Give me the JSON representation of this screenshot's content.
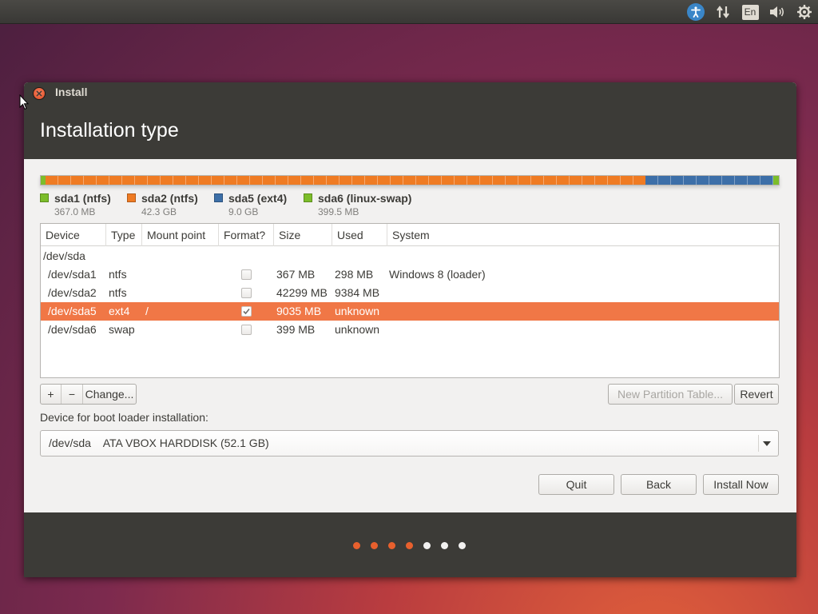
{
  "top_panel": {
    "icons": [
      "accessibility-icon",
      "network-icon",
      "keyboard-layout-icon",
      "sound-icon",
      "settings-gear-icon"
    ],
    "keyboard_layout": "En",
    "accent_color": "#3a86c8"
  },
  "window": {
    "title": "Install",
    "page_title": "Installation type"
  },
  "partition_bar": {
    "segments": [
      {
        "name": "sda1",
        "color": "#7cbd2a",
        "fraction": 0.007
      },
      {
        "name": "sda2",
        "color": "#ef7b23",
        "fraction": 0.812
      },
      {
        "name": "sda5",
        "color": "#3d6fa8",
        "fraction": 0.173
      },
      {
        "name": "sda6",
        "color": "#7cbd2a",
        "fraction": 0.008
      }
    ]
  },
  "legend": [
    {
      "label": "sda1 (ntfs)",
      "size": "367.0 MB",
      "color": "#7cbd2a"
    },
    {
      "label": "sda2 (ntfs)",
      "size": "42.3 GB",
      "color": "#ef7b23"
    },
    {
      "label": "sda5 (ext4)",
      "size": "9.0 GB",
      "color": "#3d6fa8"
    },
    {
      "label": "sda6 (linux-swap)",
      "size": "399.5 MB",
      "color": "#7cbd2a"
    }
  ],
  "table": {
    "columns": [
      "Device",
      "Type",
      "Mount point",
      "Format?",
      "Size",
      "Used",
      "System"
    ],
    "group": "/dev/sda",
    "rows": [
      {
        "device": "/dev/sda1",
        "type": "ntfs",
        "mount": "",
        "format": false,
        "size": "367 MB",
        "used": "298 MB",
        "system": "Windows 8 (loader)",
        "selected": false
      },
      {
        "device": "/dev/sda2",
        "type": "ntfs",
        "mount": "",
        "format": false,
        "size": "42299 MB",
        "used": "9384 MB",
        "system": "",
        "selected": false
      },
      {
        "device": "/dev/sda5",
        "type": "ext4",
        "mount": "/",
        "format": true,
        "size": "9035 MB",
        "used": "unknown",
        "system": "",
        "selected": true
      },
      {
        "device": "/dev/sda6",
        "type": "swap",
        "mount": "",
        "format": false,
        "size": "399 MB",
        "used": "unknown",
        "system": "",
        "selected": false
      }
    ],
    "selected_color": "#f07746"
  },
  "partition_buttons": {
    "add": "+",
    "remove": "−",
    "change": "Change...",
    "new_table": "New Partition Table...",
    "revert": "Revert"
  },
  "boot_loader": {
    "label": "Device for boot loader installation:",
    "value": "/dev/sda    ATA VBOX HARDDISK (52.1 GB)"
  },
  "actions": {
    "quit": "Quit",
    "back": "Back",
    "install_now": "Install Now"
  },
  "progress": {
    "total_steps": 7,
    "completed_steps": 4,
    "active_color": "#e8602d",
    "inactive_color": "#f2f1f0"
  }
}
